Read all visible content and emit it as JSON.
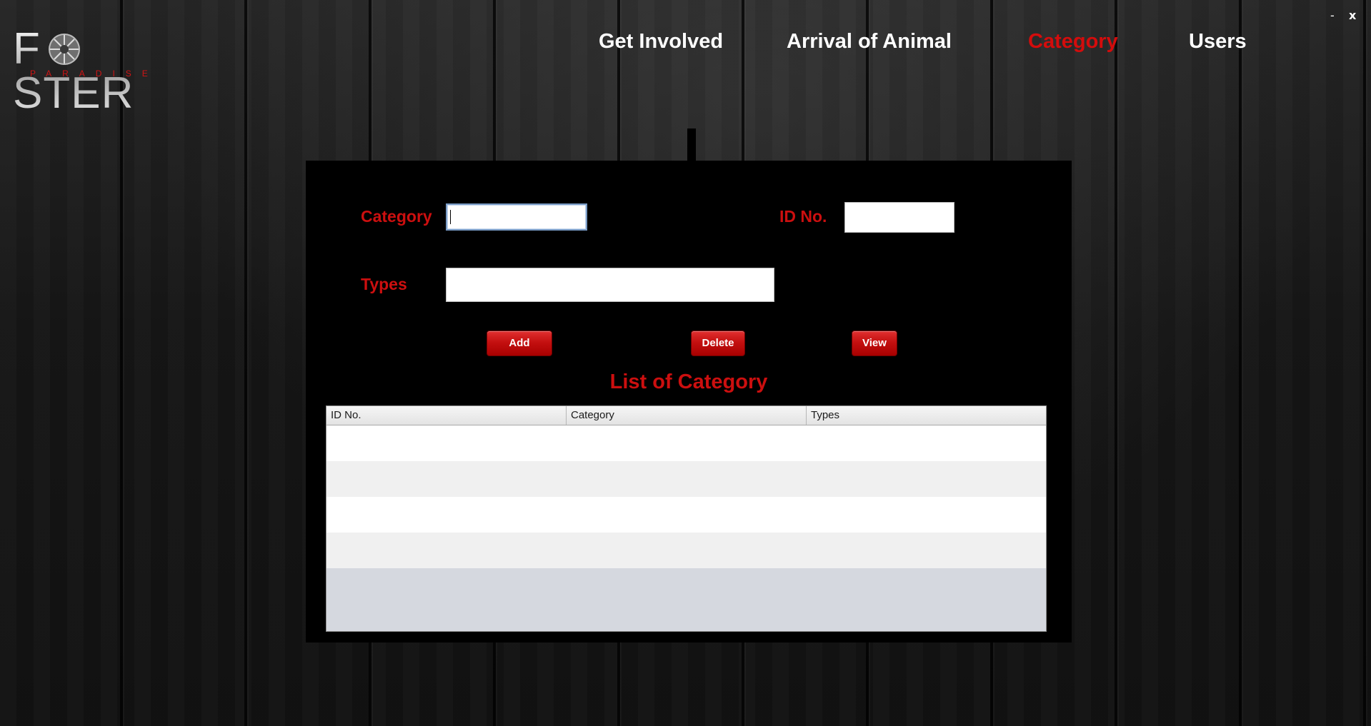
{
  "window": {
    "minimize_label": "-",
    "close_label": "x"
  },
  "logo": {
    "word": "F  STER",
    "tagline": "PARADISE"
  },
  "nav": {
    "items": [
      {
        "label": "Get Involved"
      },
      {
        "label": "Arrival of Animal"
      },
      {
        "label": "Category",
        "active": true
      },
      {
        "label": "Users"
      }
    ]
  },
  "form": {
    "category_label": "Category",
    "category_value": "",
    "idno_label": "ID No.",
    "idno_value": "",
    "types_label": "Types",
    "types_value": ""
  },
  "buttons": {
    "add_label": "Add",
    "delete_label": "Delete",
    "view_label": "View"
  },
  "list": {
    "title": "List of Category",
    "columns": [
      "ID No.",
      "Category",
      "Types"
    ],
    "rows": []
  },
  "colors": {
    "accent_red": "#cc0f0f",
    "panel": "#000000"
  }
}
